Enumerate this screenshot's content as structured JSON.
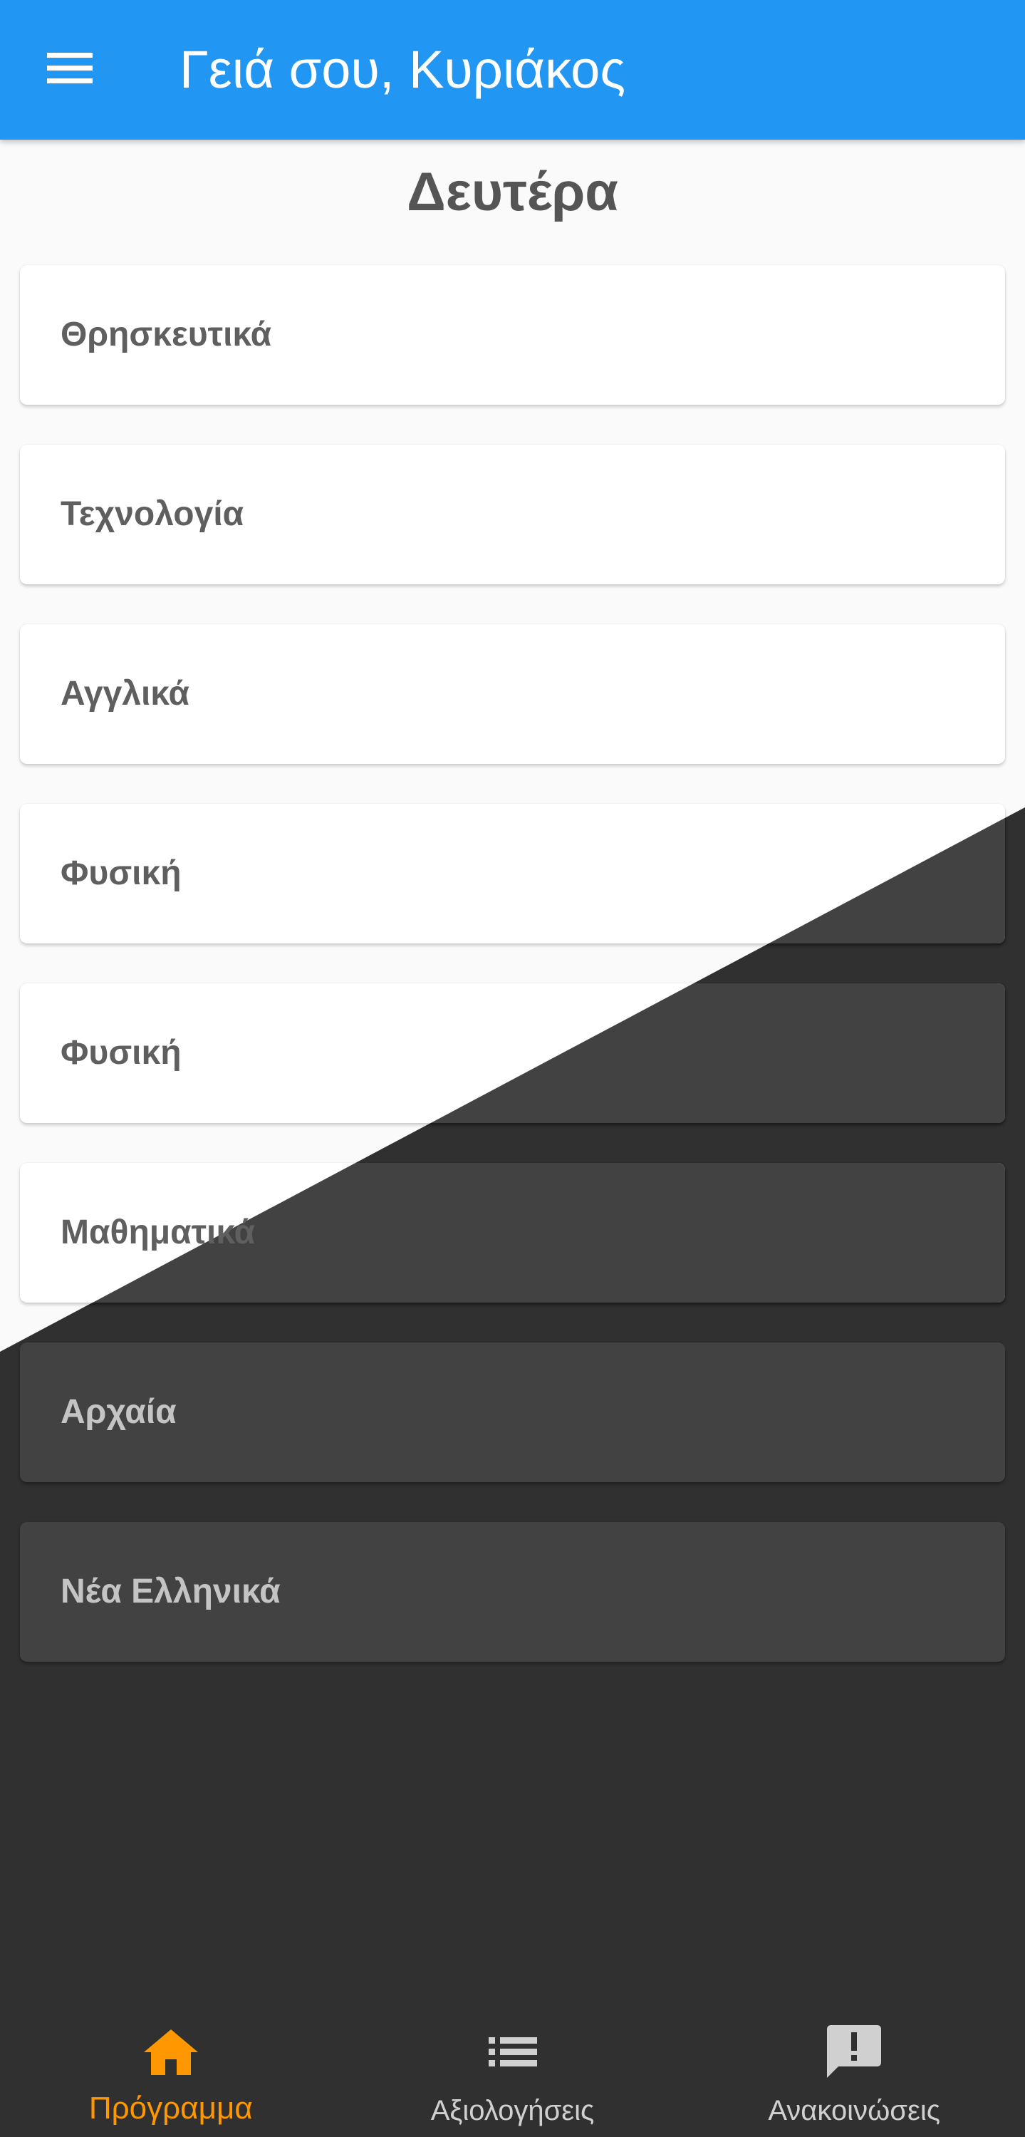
{
  "app_bar": {
    "title": "Γειά σου, Κυριάκος",
    "menu_icon": "menu-icon",
    "color": "#2196f3"
  },
  "day_title": "Δευτέρα",
  "lessons": [
    {
      "label": "Θρησκευτικά"
    },
    {
      "label": "Τεχνολογία"
    },
    {
      "label": "Αγγλικά"
    },
    {
      "label": "Φυσική"
    },
    {
      "label": "Φυσική"
    },
    {
      "label": "Μαθηματικά"
    },
    {
      "label": "Αρχαία"
    },
    {
      "label": "Νέα Ελληνικά"
    }
  ],
  "bottom_nav": {
    "items": [
      {
        "label": "Πρόγραμμα",
        "icon": "home-icon",
        "active": true
      },
      {
        "label": "Αξιολογήσεις",
        "icon": "list-icon",
        "active": false
      },
      {
        "label": "Ανακοινώσεις",
        "icon": "announcement-icon",
        "active": false
      }
    ],
    "active_color": "#ff9800"
  },
  "theme": {
    "light_background": "#fafafa",
    "dark_background": "#303030",
    "dark_card": "#424242"
  }
}
